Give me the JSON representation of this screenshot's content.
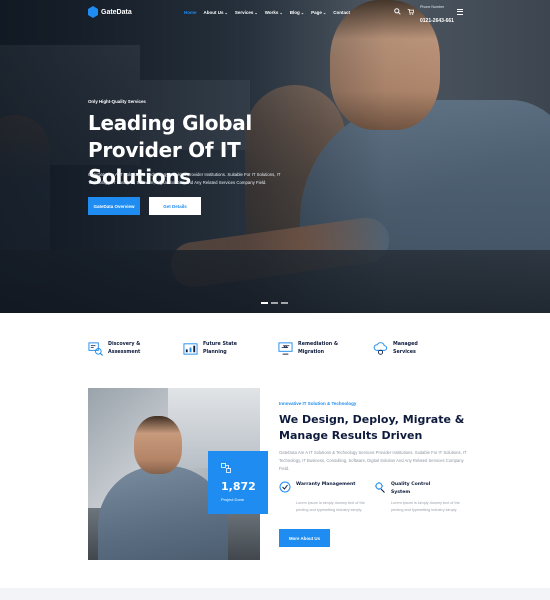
{
  "brand": {
    "name": "GateData",
    "accent": "#1e8cf0",
    "dark": "#0e1b3d"
  },
  "nav": {
    "items": [
      {
        "label": "Home",
        "active": true,
        "dropdown": false
      },
      {
        "label": "About Us",
        "dropdown": true
      },
      {
        "label": "Services",
        "dropdown": true
      },
      {
        "label": "Works",
        "dropdown": true
      },
      {
        "label": "Blog",
        "dropdown": true
      },
      {
        "label": "Page",
        "dropdown": true
      },
      {
        "label": "Contact",
        "dropdown": false
      }
    ],
    "icons": [
      "search-icon",
      "cart-icon",
      "menu-icon"
    ],
    "phone_label": "Phone Number",
    "phone_number": "0121-2643-661"
  },
  "hero": {
    "tagline": "Only Hight-Quality Services",
    "title": "Leading Global Provider Of IT Solutions",
    "description": "GateData Are A IT Solutions & Technology Services Provider Institutions. Suitable For IT Solutions, IT Technology, IT Business, Software, Digital Solution And Any Related Services Company Field.",
    "primary_button": "GateData Overview",
    "secondary_button": "Get Details",
    "slider_dots": 3,
    "active_dot": 0
  },
  "services": [
    {
      "icon": "discovery-icon",
      "label": "Discovery & Assessment"
    },
    {
      "icon": "planning-icon",
      "label": "Future State Planning"
    },
    {
      "icon": "migration-icon",
      "label": "Remediation & Migration"
    },
    {
      "icon": "cloud-services-icon",
      "label": "Managed Services"
    }
  ],
  "about": {
    "stat_value": "1,872",
    "stat_label": "Project Done",
    "kicker": "Innovative IT Solution & Technology",
    "title": "We Design, Deploy, Migrate & Manage Results Driven",
    "description": "GateData Are A IT Solutions & Technology Services Provider Institutions. Suitable For IT Solutions, IT Technology, IT Business, Consulting, Software, Digital Solution And Any Related Services Company Field.",
    "features": [
      {
        "icon": "warranty-icon",
        "title": "Warranty Management",
        "desc": "Lorem ipsum is simply dummy text of the printing and typesetting industry simply."
      },
      {
        "icon": "quality-icon",
        "title": "Quality Control System",
        "desc": "Lorem ipsum is simply dummy text of the printing and typesetting industry simply."
      }
    ],
    "button": "More About Us"
  }
}
